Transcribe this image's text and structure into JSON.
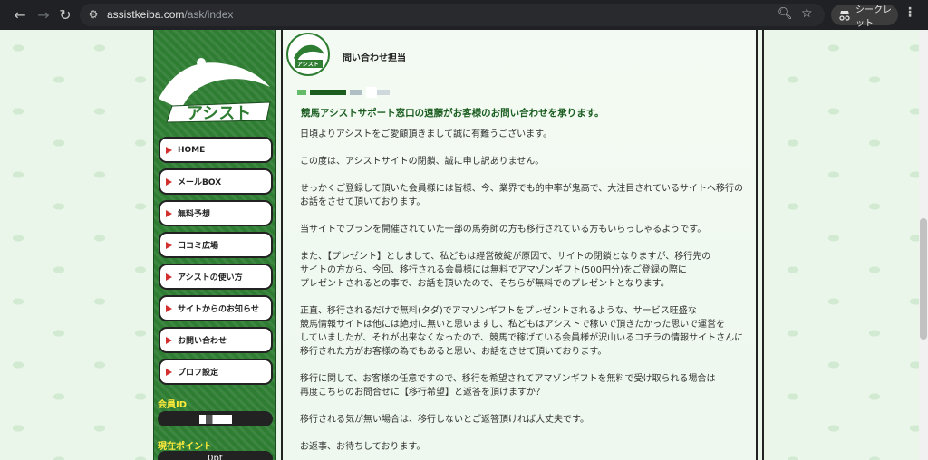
{
  "browser": {
    "url_host": "assistkeiba.com",
    "url_path": "/ask/index",
    "incognito_label": "シークレット"
  },
  "sidebar": {
    "logo_text": "アシスト",
    "menu": [
      {
        "label": "HOME"
      },
      {
        "label": "メールBOX"
      },
      {
        "label": "無料予想"
      },
      {
        "label": "口コミ広場"
      },
      {
        "label": "アシストの使い方"
      },
      {
        "label": "サイトからのお知らせ"
      },
      {
        "label": "お問い合わせ"
      },
      {
        "label": "プロフ設定"
      }
    ],
    "member_id_label": "会員ID",
    "points_label": "現在ポイント",
    "points_value": "0pt"
  },
  "message": {
    "avatar_text": "アシスト",
    "sender": "問い合わせ担当",
    "headline": "競馬アシストサポート窓口の遠藤がお客様のお問い合わせを承ります。",
    "paragraphs": [
      [
        "日頃よりアシストをご愛顧頂きまして誠に有難うございます。"
      ],
      [
        "この度は、アシストサイトの閉鎖、誠に申し訳ありません。"
      ],
      [
        "せっかくご登録して頂いた会員様には皆様、今、業界でも的中率が鬼高で、大注目されているサイトへ移行の",
        "お話をさせて頂いております。"
      ],
      [
        "当サイトでプランを開催されていた一部の馬券師の方も移行されている方もいらっしゃるようです。"
      ],
      [
        "また、【プレゼント】としまして、私どもは経営破綻が原因で、サイトの閉鎖となりますが、移行先の",
        "サイトの方から、今回、移行される会員様には無料でアマゾンギフト(500円分)をご登録の際に",
        "プレゼントされるとの事で、お話を頂いたので、そちらが無料でのプレゼントとなります。"
      ],
      [
        "正直、移行されるだけで無料(タダ)でアマゾンギフトをプレゼントされるような、サービス旺盛な",
        "競馬情報サイトは他には絶対に無いと思いますし、私どもはアシストで稼いで頂きたかった思いで運営を",
        "していましたが、それが出来なくなったので、競馬で稼げている会員様が沢山いるコチラの情報サイトさんに",
        "移行された方がお客様の為でもあると思い、お話をさせて頂いております。"
      ],
      [
        "移行に関して、お客様の任意ですので、移行を希望されてアマゾンギフトを無料で受け取られる場合は",
        "再度こちらのお問合せに【移行希望】と返答を頂けますか？"
      ],
      [
        "移行される気が無い場合は、移行しないとご返答頂ければ大丈夫です。"
      ],
      [
        "お返事、お待ちしております。"
      ]
    ]
  },
  "colors": {
    "sidebar_green": "#2e7d32",
    "headline_green": "#1b5e20",
    "accent_red": "#d32f2f",
    "label_yellow": "#ffeb3b"
  }
}
